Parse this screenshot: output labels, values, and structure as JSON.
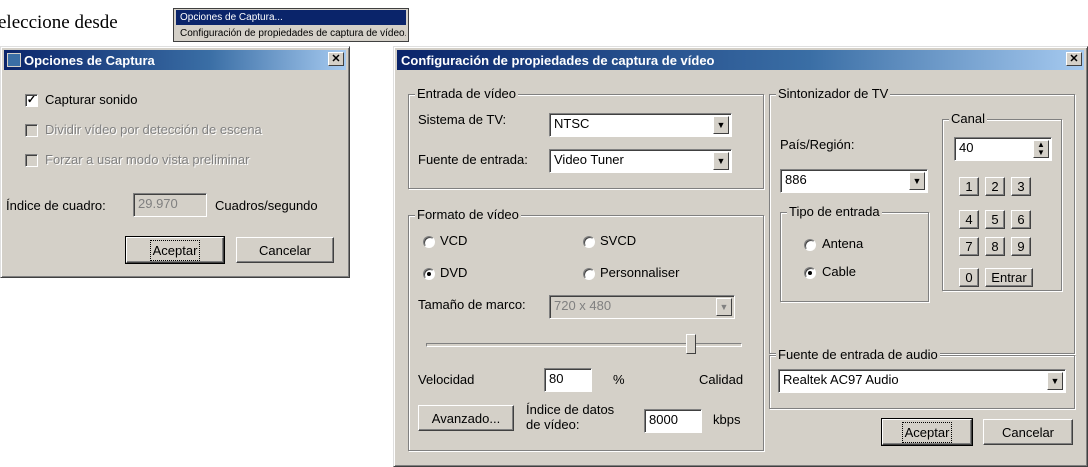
{
  "background_text": "eleccione desde",
  "context_menu": {
    "items": [
      {
        "label": "Opciones de Captura..."
      },
      {
        "label": "Configuración de propiedades de captura de vídeo..."
      }
    ]
  },
  "capture_options": {
    "title": "Opciones de Captura",
    "capture_sound_label": "Capturar sonido",
    "capture_sound_checked": true,
    "split_scene_label": "Dividir vídeo por detección de escena",
    "force_preview_label": "Forzar a usar modo vista preliminar",
    "frame_rate_label": "Índice de cuadro:",
    "frame_rate_value": "29.970",
    "frame_rate_unit": "Cuadros/segundo",
    "ok_label": "Aceptar",
    "cancel_label": "Cancelar"
  },
  "video_props": {
    "title": "Configuración de propiedades de captura de vídeo",
    "video_input": {
      "group_label": "Entrada de vídeo",
      "tv_system_label": "Sistema de TV:",
      "tv_system_value": "NTSC",
      "input_source_label": "Fuente de entrada:",
      "input_source_value": "Video Tuner"
    },
    "video_format": {
      "group_label": "Formato de vídeo",
      "options": [
        "VCD",
        "SVCD",
        "DVD",
        "Personnaliser"
      ],
      "selected": "DVD",
      "frame_size_label": "Tamaño de marco:",
      "frame_size_value": "720 x 480",
      "slider_level": 0.85,
      "speed_label": "Velocidad",
      "quality_value": "80",
      "quality_unit": "%",
      "quality_label": "Calidad",
      "advanced_label": "Avanzado...",
      "data_rate_label_line1": "Índice de datos",
      "data_rate_label_line2": "de vídeo:",
      "data_rate_value": "8000",
      "data_rate_unit": "kbps"
    },
    "tv_tuner": {
      "group_label": "Sintonizador de TV",
      "country_label": "País/Región:",
      "country_value": "886",
      "input_type_label": "Tipo de entrada",
      "antenna_label": "Antena",
      "cable_label": "Cable",
      "selected_input": "Cable",
      "channel_label": "Canal",
      "channel_value": "40",
      "keys": [
        "1",
        "2",
        "3",
        "4",
        "5",
        "6",
        "7",
        "8",
        "9",
        "0"
      ],
      "enter_label": "Entrar"
    },
    "audio_input": {
      "group_label": "Fuente de entrada de audio",
      "value": "Realtek AC97 Audio"
    },
    "ok_label": "Aceptar",
    "cancel_label": "Cancelar"
  },
  "colors": {
    "face": "#d4d0c8",
    "title_start": "#0a246a",
    "title_end": "#a6caf0"
  }
}
